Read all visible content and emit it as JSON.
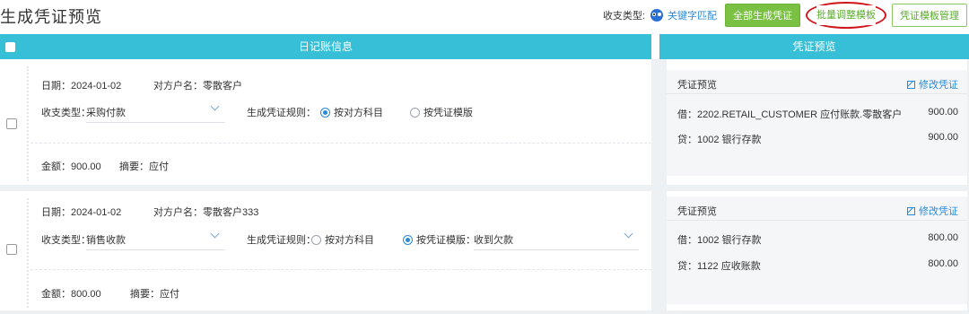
{
  "page_title": "生成凭证预览",
  "toolbar": {
    "type_label": "收支类型:",
    "keyword_match": "关键字匹配",
    "generate_all": "全部生成凭证",
    "batch_adjust": "批量调整模板",
    "template_manage": "凭证模板管理"
  },
  "left_header": "日记账信息",
  "right_header": "凭证预览",
  "entries": [
    {
      "date": "日期：2024-01-02",
      "counterparty": "对方户名：零散客户",
      "type_label": "收支类型：",
      "type_value": "采购付款",
      "rule_label": "生成凭证规则：",
      "rule_opt1": "按对方科目",
      "rule_opt2": "按凭证模版",
      "template_value": "",
      "amount": "金额：900.00",
      "summary": "摘要：应付",
      "preview": {
        "title": "凭证预览",
        "edit": "修改凭证",
        "lines": [
          {
            "text": "借：2202.RETAIL_CUSTOMER 应付账款.零散客户",
            "amount": "900.00"
          },
          {
            "text": "贷：1002 银行存款",
            "amount": "900.00"
          }
        ]
      }
    },
    {
      "date": "日期：2024-01-02",
      "counterparty": "对方户名：零散客户333",
      "type_label": "收支类型：",
      "type_value": "销售收款",
      "rule_label": "生成凭证规则：",
      "rule_opt1": "按对方科目",
      "rule_opt2": "按凭证模版：",
      "template_value": "收到欠款",
      "amount": "金额：800.00",
      "summary": "摘要：应付",
      "preview": {
        "title": "凭证预览",
        "edit": "修改凭证",
        "lines": [
          {
            "text": "借：1002 银行存款",
            "amount": "800.00"
          },
          {
            "text": "贷：1122 应收账款",
            "amount": "800.00"
          }
        ]
      }
    }
  ]
}
